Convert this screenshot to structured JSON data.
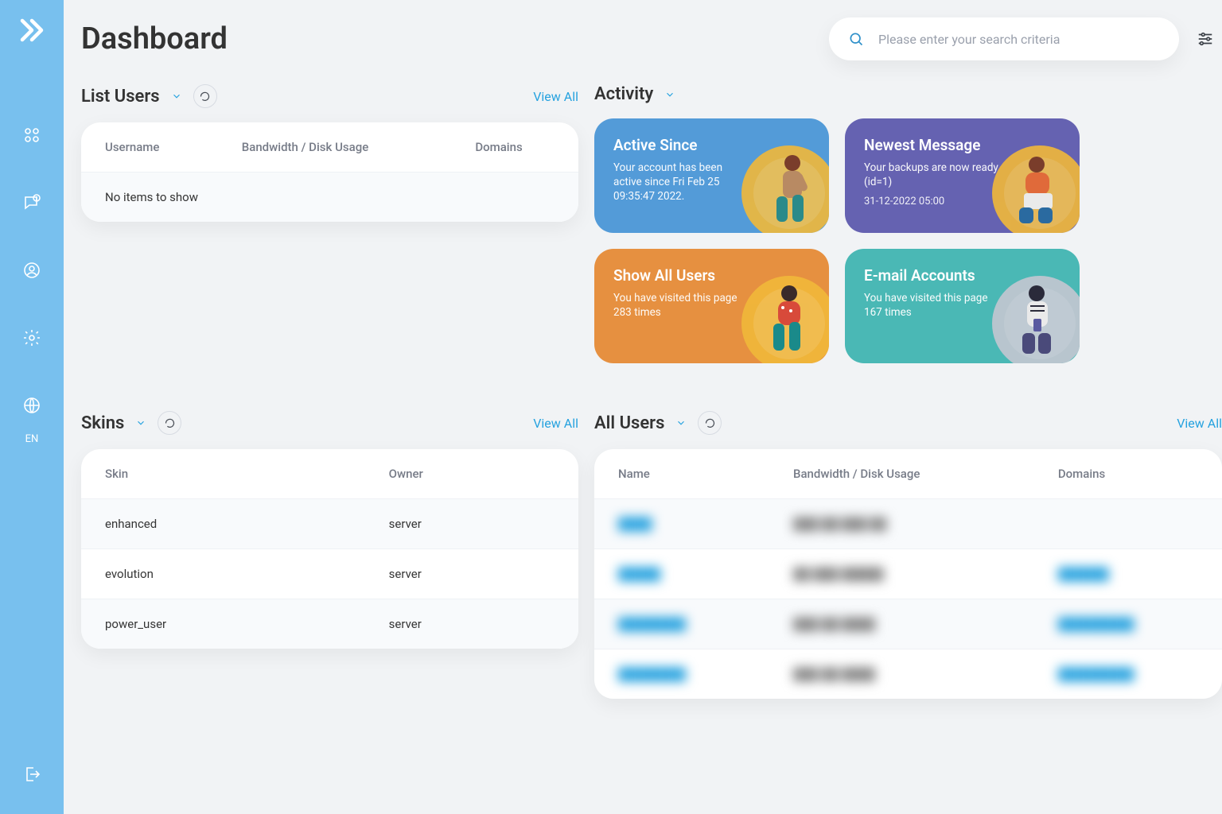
{
  "header": {
    "title": "Dashboard"
  },
  "search": {
    "placeholder": "Please enter your search criteria"
  },
  "sidebar": {
    "language": "EN"
  },
  "sections": {
    "list_users": {
      "title": "List Users",
      "view_all": "View All",
      "columns": [
        "Username",
        "Bandwidth / Disk Usage",
        "Domains"
      ],
      "empty": "No items to show"
    },
    "activity": {
      "title": "Activity",
      "cards": [
        {
          "title": "Active Since",
          "body": "Your account has been active since Fri Feb 25 09:35:47 2022.",
          "timestamp": ""
        },
        {
          "title": "Newest Message",
          "body": "Your backups are now ready (id=1)",
          "timestamp": "31-12-2022 05:00"
        },
        {
          "title": "Show All Users",
          "body": "You have visited this page 283 times",
          "timestamp": ""
        },
        {
          "title": "E-mail Accounts",
          "body": "You have visited this page 167 times",
          "timestamp": ""
        }
      ]
    },
    "skins": {
      "title": "Skins",
      "view_all": "View All",
      "columns": [
        "Skin",
        "Owner"
      ],
      "rows": [
        {
          "skin": "enhanced",
          "owner": "server"
        },
        {
          "skin": "evolution",
          "owner": "server"
        },
        {
          "skin": "power_user",
          "owner": "server"
        }
      ]
    },
    "all_users": {
      "title": "All Users",
      "view_all": "View All",
      "columns": [
        "Name",
        "Bandwidth / Disk Usage",
        "Domains"
      ]
    }
  }
}
